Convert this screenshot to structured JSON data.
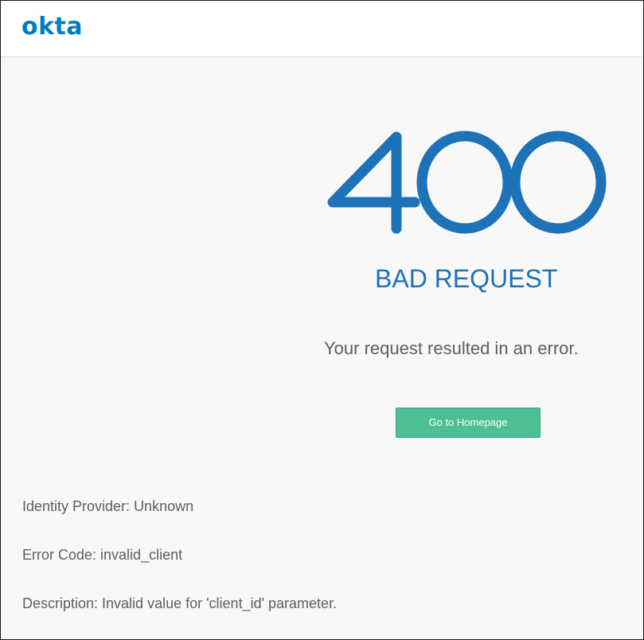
{
  "header": {
    "logo_text": "okta",
    "logo_color": "#007dc1"
  },
  "error": {
    "code": "400",
    "title": "BAD REQUEST",
    "message": "Your request resulted in an error.",
    "accent_color": "#1d72b8"
  },
  "actions": {
    "home_button_label": "Go to Homepage",
    "button_color": "#4cbf95"
  },
  "details": {
    "identity_provider": "Identity Provider: Unknown",
    "error_code": "Error Code: invalid_client",
    "description": "Description: Invalid value for 'client_id' parameter."
  }
}
